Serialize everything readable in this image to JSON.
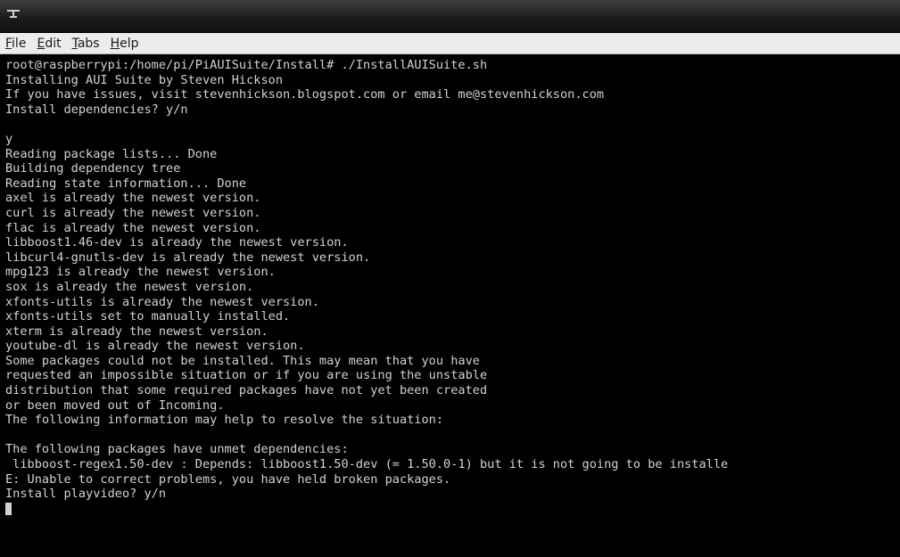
{
  "window": {
    "icon": "terminal-window-icon"
  },
  "menu": {
    "items": [
      {
        "mnemonic": "F",
        "rest": "ile"
      },
      {
        "mnemonic": "E",
        "rest": "dit"
      },
      {
        "mnemonic": "T",
        "rest": "abs"
      },
      {
        "mnemonic": "H",
        "rest": "elp"
      }
    ]
  },
  "terminal": {
    "lines": [
      "root@raspberrypi:/home/pi/PiAUISuite/Install# ./InstallAUISuite.sh",
      "Installing AUI Suite by Steven Hickson",
      "If you have issues, visit stevenhickson.blogspot.com or email me@stevenhickson.com",
      "Install dependencies? y/n",
      "",
      "y",
      "Reading package lists... Done",
      "Building dependency tree",
      "Reading state information... Done",
      "axel is already the newest version.",
      "curl is already the newest version.",
      "flac is already the newest version.",
      "libboost1.46-dev is already the newest version.",
      "libcurl4-gnutls-dev is already the newest version.",
      "mpg123 is already the newest version.",
      "sox is already the newest version.",
      "xfonts-utils is already the newest version.",
      "xfonts-utils set to manually installed.",
      "xterm is already the newest version.",
      "youtube-dl is already the newest version.",
      "Some packages could not be installed. This may mean that you have",
      "requested an impossible situation or if you are using the unstable",
      "distribution that some required packages have not yet been created",
      "or been moved out of Incoming.",
      "The following information may help to resolve the situation:",
      "",
      "The following packages have unmet dependencies:",
      " libboost-regex1.50-dev : Depends: libboost1.50-dev (= 1.50.0-1) but it is not going to be installe",
      "E: Unable to correct problems, you have held broken packages.",
      "Install playvideo? y/n"
    ]
  }
}
